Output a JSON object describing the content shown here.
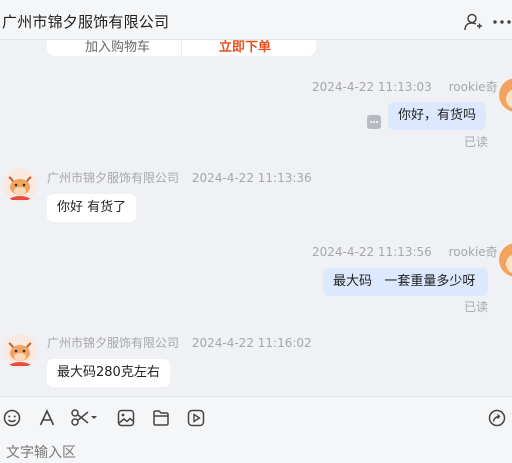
{
  "header": {
    "title": "广州市锦夕服饰有限公司"
  },
  "top_card": {
    "left_label": "加入购物车",
    "right_label": "立即下单"
  },
  "messages": [
    {
      "direction": "out",
      "sender": "rookie奇",
      "time": "2024-4-22 11:13:03",
      "text": "你好，有货吗",
      "status": "已读"
    },
    {
      "direction": "in",
      "sender": "广州市锦夕服饰有限公司",
      "time": "2024-4-22 11:13:36",
      "text": "你好 有货了"
    },
    {
      "direction": "out",
      "sender": "rookie奇",
      "time": "2024-4-22 11:13:56",
      "text": "最大码   一套重量多少呀",
      "status": "已读"
    },
    {
      "direction": "in",
      "sender": "广州市锦夕服饰有限公司",
      "time": "2024-4-22 11:16:02",
      "text": "最大码280克左右"
    }
  ],
  "toolbar": {
    "icons": [
      "emoji-icon",
      "font-icon",
      "scissors-icon",
      "image-icon",
      "file-icon",
      "video-icon",
      "share-icon"
    ]
  },
  "input": {
    "placeholder": "文字输入区"
  },
  "colors": {
    "background": "#f0f1f5",
    "out_bubble": "#dbe8fd",
    "in_bubble": "#ffffff",
    "accent": "#e8501f"
  }
}
